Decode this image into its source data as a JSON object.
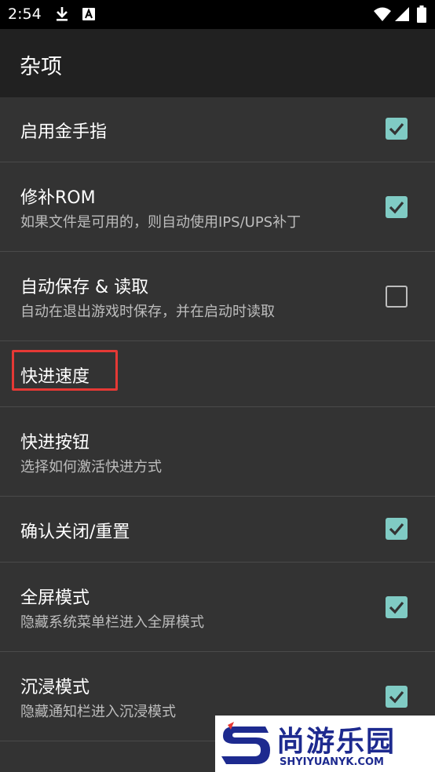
{
  "status_bar": {
    "time": "2:54",
    "icons": [
      "download-icon",
      "app-notification-icon",
      "wifi-icon",
      "signal-icon",
      "battery-icon"
    ]
  },
  "app_bar": {
    "title": "杂项"
  },
  "settings": [
    {
      "title": "启用金手指",
      "summary": "",
      "checkbox": true
    },
    {
      "title": "修补ROM",
      "summary": "如果文件是可用的，则自动使用IPS/UPS补丁",
      "checkbox": true
    },
    {
      "title": "自动保存 & 读取",
      "summary": "自动在退出游戏时保存，并在启动时读取",
      "checkbox": false
    },
    {
      "title": "快进速度",
      "summary": "",
      "checkbox": null
    },
    {
      "title": "快进按钮",
      "summary": "选择如何激活快进方式",
      "checkbox": null
    },
    {
      "title": "确认关闭/重置",
      "summary": "",
      "checkbox": true
    },
    {
      "title": "全屏模式",
      "summary": "隐藏系统菜单栏进入全屏模式",
      "checkbox": true
    },
    {
      "title": "沉浸模式",
      "summary": "隐藏通知栏进入沉浸模式",
      "checkbox": true
    }
  ],
  "colors": {
    "accent": "#80cbc4",
    "background": "#333333",
    "appbar": "#212121",
    "highlight": "#e53935"
  },
  "watermark": {
    "name": "尚游乐园",
    "url": "SHYIYUANYK.COM"
  }
}
